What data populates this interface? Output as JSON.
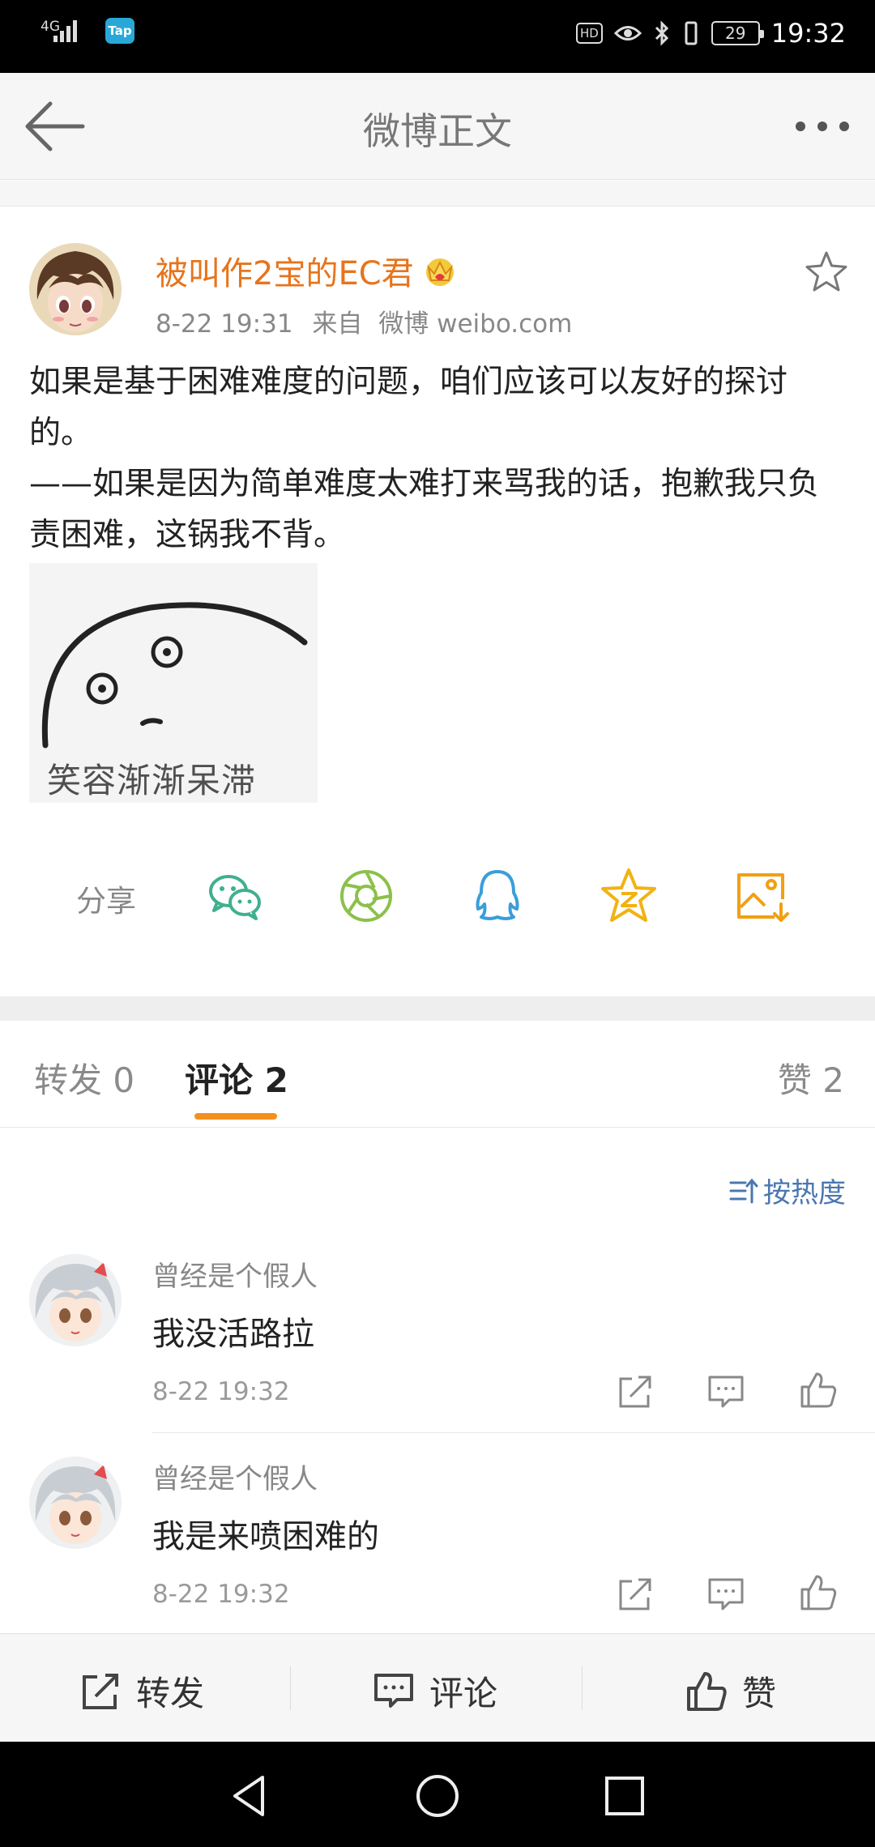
{
  "status_bar": {
    "network": "4G",
    "app_badge": "Tap",
    "hd": "HD",
    "battery": "29",
    "time": "19:32"
  },
  "nav": {
    "title": "微博正文",
    "back_icon": "back-arrow-icon",
    "more_icon": "more-dots-icon"
  },
  "post": {
    "author": "被叫作2宝的EC君",
    "time": "8-22 19:31",
    "source_prefix": "来自",
    "source": "微博 weibo.com",
    "body_lines": [
      "如果是基于困难难度的问题，咱们应该可以友好的探讨的。",
      "——如果是因为简单难度太难打来骂我的话，抱歉我只负责困难，这锅我不背。"
    ],
    "image_caption": "笑容渐渐呆滞",
    "colors": {
      "author": "#e8741c"
    }
  },
  "share": {
    "label": "分享",
    "icons": [
      "wechat-icon",
      "moments-icon",
      "qq-icon",
      "qzone-icon",
      "save-image-icon"
    ]
  },
  "tabs": {
    "repost": "转发 0",
    "comment": "评论 2",
    "like": "赞 2",
    "active_color": "#f5901e"
  },
  "sort": {
    "label": "按热度"
  },
  "comments": [
    {
      "name": "曾经是个假人",
      "text": "我没活路拉",
      "time": "8-22 19:32"
    },
    {
      "name": "曾经是个假人",
      "text": "我是来喷困难的",
      "time": "8-22 19:32"
    }
  ],
  "bottom_bar": {
    "repost": "转发",
    "comment": "评论",
    "like": "赞"
  }
}
